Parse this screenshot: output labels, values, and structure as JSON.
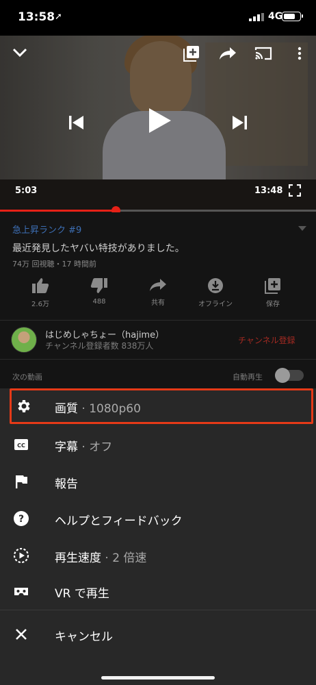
{
  "status_bar": {
    "time": "13:58",
    "location_glyph": "➚",
    "network": "4G"
  },
  "player": {
    "current_time": "5:03",
    "duration": "13:48",
    "progress_fraction": 0.366,
    "accent": "#e62117"
  },
  "video_info": {
    "trending": "急上昇ランク #9",
    "title": "最近発見したヤバい特技がありました。",
    "meta": "74万 回視聴・17 時間前",
    "actions": [
      {
        "icon": "like-icon",
        "label": "2.6万"
      },
      {
        "icon": "dislike-icon",
        "label": "488"
      },
      {
        "icon": "share-icon",
        "label": "共有"
      },
      {
        "icon": "offline-icon",
        "label": "オフライン"
      },
      {
        "icon": "save-icon",
        "label": "保存"
      }
    ]
  },
  "channel": {
    "name": "はじめしゃちょー（hajime）",
    "subscribers": "チャンネル登録者数 838万人",
    "subscribe_label": "チャンネル登録"
  },
  "up_next": {
    "label": "次の動画",
    "autoplay_label": "自動再生",
    "autoplay_on": false
  },
  "menu": {
    "highlight_color": "#e63a18",
    "items": [
      {
        "icon": "gear-icon",
        "label": "画質",
        "sub": " · 1080p60"
      },
      {
        "icon": "cc-icon",
        "label": "字幕",
        "sub": " · オフ"
      },
      {
        "icon": "flag-icon",
        "label": "報告",
        "sub": ""
      },
      {
        "icon": "help-icon",
        "label": "ヘルプとフィードバック",
        "sub": ""
      },
      {
        "icon": "speed-icon",
        "label": "再生速度",
        "sub": " · 2 倍速"
      },
      {
        "icon": "vr-icon",
        "label": "VR で再生",
        "sub": ""
      }
    ],
    "cancel": {
      "icon": "close-icon",
      "label": "キャンセル"
    }
  }
}
